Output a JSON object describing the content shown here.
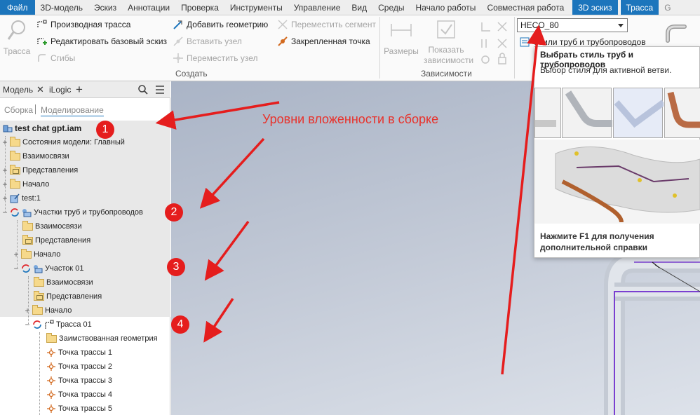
{
  "menu": {
    "items": [
      "Файл",
      "3D-модель",
      "Эскиз",
      "Аннотации",
      "Проверка",
      "Инструменты",
      "Управление",
      "Вид",
      "Среды",
      "Начало работы",
      "Совместная работа"
    ],
    "context_tab": "3D эскиз",
    "active_tab": "Трасса",
    "overflow": "G"
  },
  "ribbon": {
    "trace_label": "Трасса",
    "derived_route": "Производная трасса",
    "edit_base_sketch": "Редактировать базовый эскиз",
    "bends": "Сгибы",
    "add_geometry": "Добавить геометрию",
    "insert_node": "Вставить узел",
    "move_node": "Переместить узел",
    "move_segment": "Переместить сегмент",
    "fixed_point": "Закрепленная точка",
    "group_create": "Создать",
    "dimensions": "Размеры",
    "show_constraints": "Показать зависимости",
    "group_constraints": "Зависимости",
    "style_value": "HECO_80",
    "style_label": "Стили труб и трубопроводов"
  },
  "tooltip": {
    "title": "Выбрать стиль труб и трубопроводов",
    "description": "Выбор стиля для активной ветви.",
    "hint": "Нажмите F1 для получения дополнительной справки"
  },
  "panel": {
    "tab_model": "Модель",
    "tab_close": "✕",
    "tab_ilogic": "iLogic",
    "tab_add": "+",
    "subtab_assembly": "Сборка",
    "subtab_modeling": "Моделирование"
  },
  "tree": [
    {
      "label": "test chat gpt.iam",
      "icon": "assembly-icon",
      "bold": true
    },
    {
      "label": "Состояния модели: Главный",
      "icon": "folder-icon"
    },
    {
      "label": "Взаимосвязи",
      "icon": "folder-icon"
    },
    {
      "label": "Представления",
      "icon": "representations-icon"
    },
    {
      "label": "Начало",
      "icon": "folder-icon"
    },
    {
      "label": "test:1",
      "icon": "part-icon"
    },
    {
      "label": "Участки труб и трубопроводов",
      "icon": "tube-run-icon"
    },
    {
      "label": "Взаимосвязи",
      "icon": "folder-icon"
    },
    {
      "label": "Представления",
      "icon": "representations-icon"
    },
    {
      "label": "Начало",
      "icon": "folder-icon"
    },
    {
      "label": "Участок 01",
      "icon": "tube-run-icon"
    },
    {
      "label": "Взаимосвязи",
      "icon": "folder-icon"
    },
    {
      "label": "Представления",
      "icon": "representations-icon"
    },
    {
      "label": "Начало",
      "icon": "folder-icon"
    },
    {
      "label": "Трасса 01",
      "icon": "route-icon"
    },
    {
      "label": "Заимствованная геометрия",
      "icon": "folder-icon"
    },
    {
      "label": "Точка трассы 1",
      "icon": "route-point-icon"
    },
    {
      "label": "Точка трассы 2",
      "icon": "route-point-icon"
    },
    {
      "label": "Точка трассы 3",
      "icon": "route-point-icon"
    },
    {
      "label": "Точка трассы 4",
      "icon": "route-point-icon"
    },
    {
      "label": "Точка трассы 5",
      "icon": "route-point-icon"
    }
  ],
  "annotation": {
    "text": "Уровни вложенности в сборке",
    "badges": [
      "1",
      "2",
      "3",
      "4"
    ],
    "color": "#e8322b"
  },
  "colors": {
    "accent": "#1c75bc",
    "annotation_red": "#e51d1d",
    "route_purple": "#7a3fd0"
  }
}
